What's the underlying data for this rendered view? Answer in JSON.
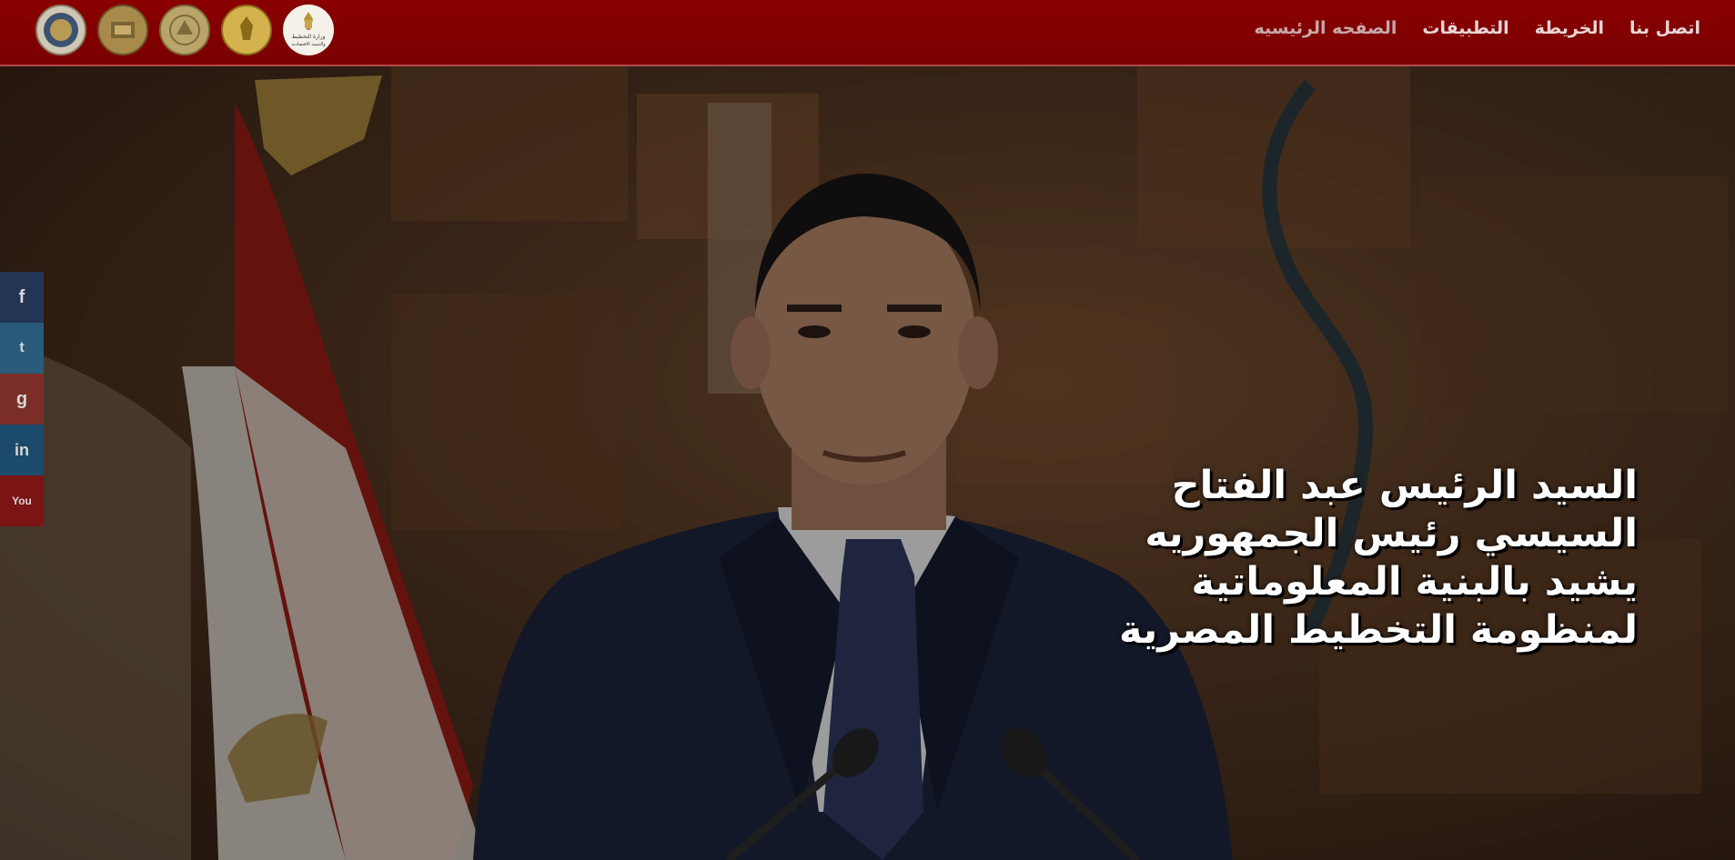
{
  "nav": {
    "links": [
      {
        "label": "الصفحه الرئيسيه",
        "active": true
      },
      {
        "label": "التطبيقات",
        "active": false
      },
      {
        "label": "الخريطة",
        "active": false
      },
      {
        "label": "اتصل بنا",
        "active": false
      }
    ],
    "logo_text": [
      "وزارة التخطيط",
      "والتنمية الاقتصادية"
    ]
  },
  "hero": {
    "headline": "السيد الرئيس عبد الفتاح السيسي رئيس الجمهوريه يشيد بالبنية المعلوماتية لمنظومة التخطيط المصرية",
    "slides": 2,
    "active_slide": 1
  },
  "social": {
    "items": [
      {
        "name": "facebook",
        "glyph": "f"
      },
      {
        "name": "twitter",
        "glyph": "t"
      },
      {
        "name": "google-plus",
        "glyph": "g"
      },
      {
        "name": "linkedin",
        "glyph": "in"
      },
      {
        "name": "youtube",
        "glyph": "You"
      }
    ]
  },
  "colors": {
    "navbar": "#7a0000",
    "headline": "#ffffff"
  }
}
